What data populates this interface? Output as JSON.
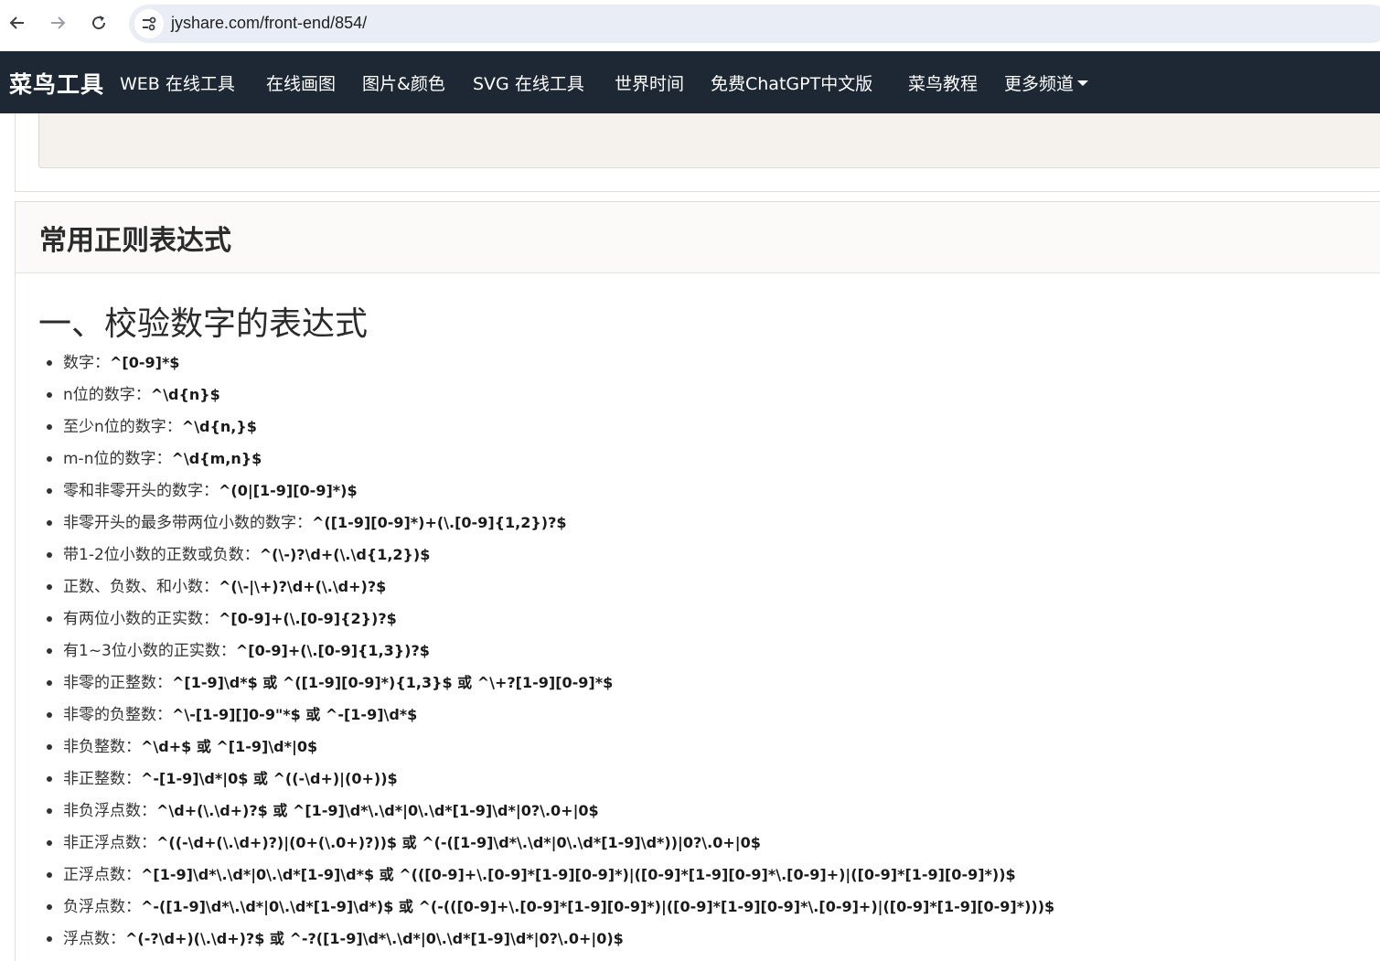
{
  "browser": {
    "url": "jyshare.com/front-end/854/"
  },
  "navbar": {
    "brand": "菜鸟工具",
    "links": [
      "WEB 在线工具",
      "在线画图",
      "图片&颜色",
      "SVG 在线工具",
      "世界时间",
      "免费ChatGPT中文版",
      "菜鸟教程",
      "更多频道"
    ]
  },
  "card": {
    "title": "常用正则表达式"
  },
  "section": {
    "title": "一、校验数字的表达式",
    "rules": [
      {
        "label": "数字：",
        "expr": "^[0-9]*$"
      },
      {
        "label": "n位的数字：",
        "expr": "^\\d{n}$"
      },
      {
        "label": "至少n位的数字：",
        "expr": "^\\d{n,}$"
      },
      {
        "label": "m-n位的数字：",
        "expr": "^\\d{m,n}$"
      },
      {
        "label": "零和非零开头的数字：",
        "expr": "^(0|[1-9][0-9]*)$"
      },
      {
        "label": "非零开头的最多带两位小数的数字：",
        "expr": "^([1-9][0-9]*)+(\\.[0-9]{1,2})?$"
      },
      {
        "label": "带1-2位小数的正数或负数：",
        "expr": "^(\\-)?\\d+(\\.\\d{1,2})$"
      },
      {
        "label": "正数、负数、和小数：",
        "expr": "^(\\-|\\+)?\\d+(\\.\\d+)?$"
      },
      {
        "label": "有两位小数的正实数：",
        "expr": "^[0-9]+(\\.[0-9]{2})?$"
      },
      {
        "label": "有1~3位小数的正实数：",
        "expr": "^[0-9]+(\\.[0-9]{1,3})?$"
      },
      {
        "label": "非零的正整数：",
        "expr": "^[1-9]\\d*$ 或 ^([1-9][0-9]*){1,3}$ 或 ^\\+?[1-9][0-9]*$"
      },
      {
        "label": "非零的负整数：",
        "expr": "^\\-[1-9][]0-9\"*$ 或 ^-[1-9]\\d*$"
      },
      {
        "label": "非负整数：",
        "expr": "^\\d+$ 或 ^[1-9]\\d*|0$"
      },
      {
        "label": "非正整数：",
        "expr": "^-[1-9]\\d*|0$ 或 ^((-\\d+)|(0+))$"
      },
      {
        "label": "非负浮点数：",
        "expr": "^\\d+(\\.\\d+)?$ 或 ^[1-9]\\d*\\.\\d*|0\\.\\d*[1-9]\\d*|0?\\.0+|0$"
      },
      {
        "label": "非正浮点数：",
        "expr": "^((-\\d+(\\.\\d+)?)|(0+(\\.0+)?))$ 或 ^(-([1-9]\\d*\\.\\d*|0\\.\\d*[1-9]\\d*))|0?\\.0+|0$"
      },
      {
        "label": "正浮点数：",
        "expr": "^[1-9]\\d*\\.\\d*|0\\.\\d*[1-9]\\d*$ 或 ^(([0-9]+\\.[0-9]*[1-9][0-9]*)|([0-9]*[1-9][0-9]*\\.[0-9]+)|([0-9]*[1-9][0-9]*))$"
      },
      {
        "label": "负浮点数：",
        "expr": "^-([1-9]\\d*\\.\\d*|0\\.\\d*[1-9]\\d*)$ 或 ^(-(([0-9]+\\.[0-9]*[1-9][0-9]*)|([0-9]*[1-9][0-9]*\\.[0-9]+)|([0-9]*[1-9][0-9]*)))$"
      },
      {
        "label": "浮点数：",
        "expr": "^(-?\\d+)(\\.\\d+)?$ 或 ^-?([1-9]\\d*\\.\\d*|0\\.\\d*[1-9]\\d*|0?\\.0+|0)$"
      }
    ]
  }
}
